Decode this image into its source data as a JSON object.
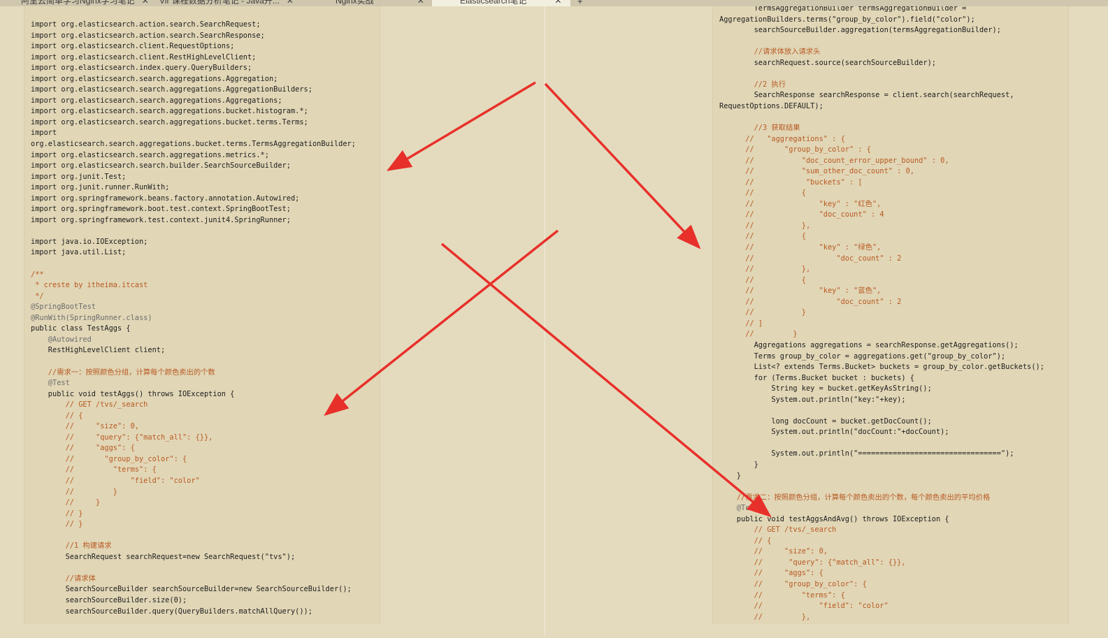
{
  "tabs": [
    {
      "label": "阿里云简单学习Nginx学习笔记",
      "close": "✕",
      "active": false
    },
    {
      "label": "Vir 课程数据分析笔记 - Java开...",
      "close": "✕",
      "active": false
    },
    {
      "label": "Nginx实战",
      "close": "✕",
      "active": false
    },
    {
      "label": "Elasticsearch笔记",
      "close": "✕",
      "active": true
    }
  ],
  "new_tab": "+",
  "left_code": [
    "import org.elasticsearch.action.search.SearchRequest;",
    "import org.elasticsearch.action.search.SearchResponse;",
    "import org.elasticsearch.client.RequestOptions;",
    "import org.elasticsearch.client.RestHighLevelClient;",
    "import org.elasticsearch.index.query.QueryBuilders;",
    "import org.elasticsearch.search.aggregations.Aggregation;",
    "import org.elasticsearch.search.aggregations.AggregationBuilders;",
    "import org.elasticsearch.search.aggregations.Aggregations;",
    "import org.elasticsearch.search.aggregations.bucket.histogram.*;",
    "import org.elasticsearch.search.aggregations.bucket.terms.Terms;",
    "import",
    "org.elasticsearch.search.aggregations.bucket.terms.TermsAggregationBuilder;",
    "import org.elasticsearch.search.aggregations.metrics.*;",
    "import org.elasticsearch.search.builder.SearchSourceBuilder;",
    "import org.junit.Test;",
    "import org.junit.runner.RunWith;",
    "import org.springframework.beans.factory.annotation.Autowired;",
    "import org.springframework.boot.test.context.SpringBootTest;",
    "import org.springframework.test.context.junit4.SpringRunner;",
    "",
    "import java.io.IOException;",
    "import java.util.List;",
    "",
    "/**",
    " * creste by itheima.itcast",
    " */",
    "@SpringBootTest",
    "@RunWith(SpringRunner.class)",
    "public class TestAggs {",
    "    @Autowired",
    "    RestHighLevelClient client;",
    "",
    "    //需求一：按照颜色分组，计算每个颜色卖出的个数",
    "    @Test",
    "    public void testAggs() throws IOException {",
    "        // GET /tvs/_search",
    "        // {",
    "        //     \"size\": 0,",
    "        //     \"query\": {\"match_all\": {}},",
    "        //     \"aggs\": {",
    "        //       \"group_by_color\": {",
    "        //         \"terms\": {",
    "        //             \"field\": \"color\"",
    "        //         }",
    "        //     }",
    "        // }",
    "        // }",
    "",
    "        //1 构建请求",
    "        SearchRequest searchRequest=new SearchRequest(\"tvs\");",
    "",
    "        //请求体",
    "        SearchSourceBuilder searchSourceBuilder=new SearchSourceBuilder();",
    "        searchSourceBuilder.size(0);",
    "        searchSourceBuilder.query(QueryBuilders.matchAllQuery());"
  ],
  "right_code": [
    "        TermsAggregationBuilder termsAggregationBuilder =",
    "AggregationBuilders.terms(\"group_by_color\").field(\"color\");",
    "        searchSourceBuilder.aggregation(termsAggregationBuilder);",
    "",
    "        //请求体放入请求头",
    "        searchRequest.source(searchSourceBuilder);",
    "",
    "        //2 执行",
    "        SearchResponse searchResponse = client.search(searchRequest,",
    "RequestOptions.DEFAULT);",
    "",
    "        //3 获取结果",
    "      //   \"aggregations\" : {",
    "      //       \"group_by_color\" : {",
    "      //           \"doc_count_error_upper_bound\" : 0,",
    "      //           \"sum_other_doc_count\" : 0,",
    "      //            \"buckets\" : [",
    "      //           {",
    "      //               \"key\" : \"红色\",",
    "      //               \"doc_count\" : 4",
    "      //           },",
    "      //           {",
    "      //               \"key\" : \"绿色\",",
    "      //                   \"doc_count\" : 2",
    "      //           },",
    "      //           {",
    "      //               \"key\" : \"蓝色\",",
    "      //                   \"doc_count\" : 2",
    "      //           }",
    "      // ]",
    "      //         }",
    "        Aggregations aggregations = searchResponse.getAggregations();",
    "        Terms group_by_color = aggregations.get(\"group_by_color\");",
    "        List<? extends Terms.Bucket> buckets = group_by_color.getBuckets();",
    "        for (Terms.Bucket bucket : buckets) {",
    "            String key = bucket.getKeyAsString();",
    "            System.out.println(\"key:\"+key);",
    "",
    "            long docCount = bucket.getDocCount();",
    "            System.out.println(\"docCount:\"+docCount);",
    "",
    "            System.out.println(\"=================================\");",
    "        }",
    "    }",
    "",
    "    //需求二：按照颜色分组，计算每个颜色卖出的个数，每个颜色卖出的平均价格",
    "    @Test",
    "    public void testAggsAndAvg() throws IOException {",
    "        // GET /tvs/_search",
    "        // {",
    "        //     \"size\": 0,",
    "        //      \"query\": {\"match_all\": {}},",
    "        //     \"aggs\": {",
    "        //     \"group_by_color\": {",
    "        //         \"terms\": {",
    "        //             \"field\": \"color\"",
    "        //         },"
  ],
  "arrow_color": "#e8302a"
}
